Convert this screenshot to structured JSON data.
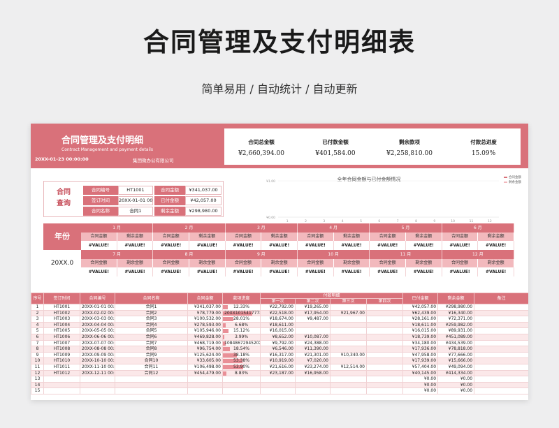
{
  "hero": {
    "title": "合同管理及支付明细表",
    "subtitle": "简单易用  /  自动统计  /  自动更新"
  },
  "colors": {
    "accent": "#d9717a",
    "accent_light": "#f2b9bd",
    "stripe": "#fbe8e9"
  },
  "header": {
    "title": "合同管理及支付明细",
    "subtitle_en": "Contract Management and payment details",
    "date": "20XX-01-23 00:00:00",
    "company": "集团微办公有限公司"
  },
  "kpis": [
    {
      "label": "合同总金额",
      "value": "¥2,660,394.00"
    },
    {
      "label": "已付款金额",
      "value": "¥401,584.00"
    },
    {
      "label": "剩余款项",
      "value": "¥2,258,810.00"
    },
    {
      "label": "付款总进度",
      "value": "15.09%"
    }
  ],
  "query": {
    "title": "合同\n查询",
    "contract_no_label": "合同编号",
    "contract_no": "HT1001",
    "amount_label": "合同金额",
    "amount": "¥341,037.00",
    "sign_time_label": "签订时间",
    "sign_time": "20XX-01-01 00:00:00",
    "paid_label": "已付金额",
    "paid": "¥42,057.00",
    "name_label": "合同名称",
    "name": "合同1",
    "remain_label": "剩余金额",
    "remain": "¥298,980.00"
  },
  "chart_data": {
    "type": "bar",
    "title": "全年合同金额与已付金额情况",
    "categories": [
      "1",
      "2",
      "3",
      "4",
      "5",
      "6",
      "7",
      "8",
      "9",
      "10",
      "11",
      "12"
    ],
    "series": [
      {
        "name": "合同金额",
        "values": [
          0,
          0,
          0,
          0,
          0,
          0,
          0,
          0,
          0,
          0,
          0,
          0
        ]
      },
      {
        "name": "剩余金额",
        "values": [
          0,
          0,
          0,
          0,
          0,
          0,
          0,
          0,
          0,
          0,
          0,
          0
        ]
      }
    ],
    "y_ticks": [
      "¥1.00",
      "¥0.00"
    ],
    "ylim": [
      0,
      1
    ],
    "legend_position": "top-right",
    "colors": [
      "#d9717a",
      "#f2b9bd"
    ]
  },
  "year": {
    "label": "年份",
    "value": "20XX.0"
  },
  "months": {
    "labels": [
      "1 月",
      "2 月",
      "3 月",
      "4 月",
      "5 月",
      "6 月",
      "7 月",
      "8 月",
      "9 月",
      "10 月",
      "11 月",
      "12 月"
    ],
    "sub_a": "合同金额",
    "sub_b": "剩余金额",
    "value": "#VALUE!"
  },
  "table": {
    "headers": {
      "no": "序号",
      "sign": "签订时间",
      "code": "合同编号",
      "name": "合同名称",
      "amount": "合同金额",
      "progress": "款项进度",
      "details": "付款明细",
      "first": "第一次",
      "second": "第二次",
      "third": "第三次",
      "fourth": "第四次",
      "paid": "已付金额",
      "remain": "剩余金额",
      "note": "备注"
    },
    "rows": [
      {
        "no": "1",
        "sign": "HT1001",
        "code": "20XX-01-01 00:00:00",
        "name": "合同1",
        "amount": "¥341,037.00",
        "progress": "12.33%",
        "pct": 0.1233,
        "p1": "¥22,792.00",
        "p2": "¥19,265.00",
        "p3": "",
        "p4": "",
        "paid": "¥42,057.00",
        "remain": "¥298,980.00"
      },
      {
        "no": "2",
        "sign": "HT1002",
        "code": "20XX-02-02 00:00:00",
        "name": "合同2",
        "amount": "¥78,779.00",
        "progress": "20XX1015417778",
        "pct": 0.79,
        "p1": "¥22,518.00",
        "p2": "¥17,954.00",
        "p3": "¥21,967.00",
        "p4": "",
        "paid": "¥62,439.00",
        "remain": "¥16,340.00"
      },
      {
        "no": "3",
        "sign": "HT1003",
        "code": "20XX-03-03 00:00:00",
        "name": "合同3",
        "amount": "¥100,532.00",
        "progress": "28.01%",
        "pct": 0.2801,
        "p1": "¥18,674.00",
        "p2": "¥9,487.00",
        "p3": "",
        "p4": "",
        "paid": "¥28,161.00",
        "remain": "¥72,371.00"
      },
      {
        "no": "4",
        "sign": "HT1004",
        "code": "20XX-04-04 00:00:00",
        "name": "合同4",
        "amount": "¥278,593.00",
        "progress": "6.68%",
        "pct": 0.0668,
        "p1": "¥18,611.00",
        "p2": "",
        "p3": "",
        "p4": "",
        "paid": "¥18,611.00",
        "remain": "¥259,982.00"
      },
      {
        "no": "5",
        "sign": "HT1005",
        "code": "20XX-05-05 00:00:00",
        "name": "合同5",
        "amount": "¥105,946.00",
        "progress": "15.12%",
        "pct": 0.1512,
        "p1": "¥16,015.00",
        "p2": "",
        "p3": "",
        "p4": "",
        "paid": "¥16,015.00",
        "remain": "¥89,931.00"
      },
      {
        "no": "6",
        "sign": "HT1006",
        "code": "20XX-06-06 00:00:00",
        "name": "合同6",
        "amount": "¥469,828.00",
        "progress": "3.99%",
        "pct": 0.0399,
        "p1": "¥8,652.00",
        "p2": "¥10,087.00",
        "p3": "",
        "p4": "",
        "paid": "¥18,739.00",
        "remain": "¥451,089.00"
      },
      {
        "no": "7",
        "sign": "HT1007",
        "code": "20XX-07-07 00:00:00",
        "name": "合同7",
        "amount": "¥468,719.00",
        "progress": "1084867294520X",
        "pct": 0.073,
        "p1": "¥9,792.00",
        "p2": "¥24,388.00",
        "p3": "",
        "p4": "",
        "paid": "¥34,180.00",
        "remain": "¥434,539.00"
      },
      {
        "no": "8",
        "sign": "HT1008",
        "code": "20XX-08-08 00:00:00",
        "name": "合同8",
        "amount": "¥96,754.00",
        "progress": "18.54%",
        "pct": 0.1854,
        "p1": "¥6,546.00",
        "p2": "¥11,390.00",
        "p3": "",
        "p4": "",
        "paid": "¥17,936.00",
        "remain": "¥78,818.00"
      },
      {
        "no": "9",
        "sign": "HT1009",
        "code": "20XX-09-09 00:00:00",
        "name": "合同9",
        "amount": "¥125,624.00",
        "progress": "38.18%",
        "pct": 0.3818,
        "p1": "¥16,317.00",
        "p2": "¥21,301.00",
        "p3": "¥10,340.00",
        "p4": "",
        "paid": "¥47,958.00",
        "remain": "¥77,666.00"
      },
      {
        "no": "10",
        "sign": "HT1010",
        "code": "20XX-10-10 00:00:00",
        "name": "合同10",
        "amount": "¥33,605.00",
        "progress": "53.38%",
        "pct": 0.5338,
        "p1": "¥10,919.00",
        "p2": "¥7,020.00",
        "p3": "",
        "p4": "",
        "paid": "¥17,939.00",
        "remain": "¥15,666.00"
      },
      {
        "no": "11",
        "sign": "HT1011",
        "code": "20XX-11-10 00:00:00",
        "name": "合同11",
        "amount": "¥106,498.00",
        "progress": "53.90%",
        "pct": 0.539,
        "p1": "¥21,616.00",
        "p2": "¥23,274.00",
        "p3": "¥12,514.00",
        "p4": "",
        "paid": "¥57,404.00",
        "remain": "¥49,094.00"
      },
      {
        "no": "12",
        "sign": "HT1012",
        "code": "20XX-12-11 00:00:00",
        "name": "合同12",
        "amount": "¥454,479.00",
        "progress": "8.83%",
        "pct": 0.0883,
        "p1": "¥23,187.00",
        "p2": "¥16,958.00",
        "p3": "",
        "p4": "",
        "paid": "¥40,145.00",
        "remain": "¥414,334.00"
      },
      {
        "no": "13",
        "sign": "",
        "code": "",
        "name": "",
        "amount": "",
        "progress": "",
        "pct": 0,
        "p1": "",
        "p2": "",
        "p3": "",
        "p4": "",
        "paid": "¥0.00",
        "remain": "¥0.00"
      },
      {
        "no": "14",
        "sign": "",
        "code": "",
        "name": "",
        "amount": "",
        "progress": "",
        "pct": 0,
        "p1": "",
        "p2": "",
        "p3": "",
        "p4": "",
        "paid": "¥0.00",
        "remain": "¥0.00"
      },
      {
        "no": "15",
        "sign": "",
        "code": "",
        "name": "",
        "amount": "",
        "progress": "",
        "pct": 0,
        "p1": "",
        "p2": "",
        "p3": "",
        "p4": "",
        "paid": "¥0.00",
        "remain": "¥0.00"
      }
    ]
  }
}
